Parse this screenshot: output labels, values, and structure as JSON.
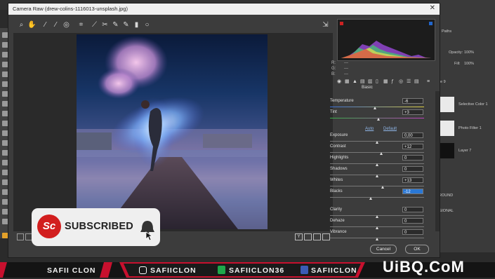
{
  "window": {
    "title": "Camera Raw (drew-colins-1116013-unsplash.jpg)",
    "close": "✕"
  },
  "histogram": {
    "r_label": "R:",
    "g_label": "G:",
    "b_label": "B:",
    "r_value": "---",
    "g_value": "---",
    "b_value": "---"
  },
  "panel": {
    "section_title": "Basic",
    "auto_label": "Auto",
    "default_label": "Default",
    "sliders": [
      {
        "label": "Temperature",
        "value": "-6",
        "level": 0.48
      },
      {
        "label": "Tint",
        "value": "+3",
        "level": 0.52
      },
      {
        "label": "Exposure",
        "value": "0,00",
        "level": 0.5
      },
      {
        "label": "Contrast",
        "value": "+12",
        "level": 0.55
      },
      {
        "label": "Highlights",
        "value": "0",
        "level": 0.5
      },
      {
        "label": "Shadows",
        "value": "0",
        "level": 0.5
      },
      {
        "label": "Whites",
        "value": "+13",
        "level": 0.56
      },
      {
        "label": "Blacks",
        "value": "-12",
        "level": 0.44
      },
      {
        "label": "Clarity",
        "value": "0",
        "level": 0.5
      },
      {
        "label": "Dehaze",
        "value": "0",
        "level": 0.5
      },
      {
        "label": "Vibrance",
        "value": "0",
        "level": 0.5
      }
    ]
  },
  "buttons": {
    "cancel": "Cancel",
    "ok": "OK"
  },
  "ps_layers": {
    "panel_label": "Paths",
    "opacity_label": "Opacity:",
    "opacity_value": "100%",
    "fill_label": "Fill:",
    "fill_value": "100%",
    "items": [
      "Selective Color 1",
      "Photo Filter 1",
      "Layer 7"
    ],
    "partial_round": "ROUND",
    "partial_gional": "GIONAL",
    "partial_9": "e 9"
  },
  "overlay": {
    "logo": "Sc",
    "subscribed": "SUBSCRIBED",
    "bell_icon": "bell-icon"
  },
  "banner": {
    "channel_name": "SAFII CLON",
    "instagram": "SAFIICLON",
    "twitter": "SAFIICLON36",
    "facebook": "SAFIICLON",
    "watermark": "UiBQ.CoM"
  },
  "colors": {
    "accent": "#2a78d6",
    "brand_red": "#d21e1e",
    "banner_red": "#c8102e"
  }
}
